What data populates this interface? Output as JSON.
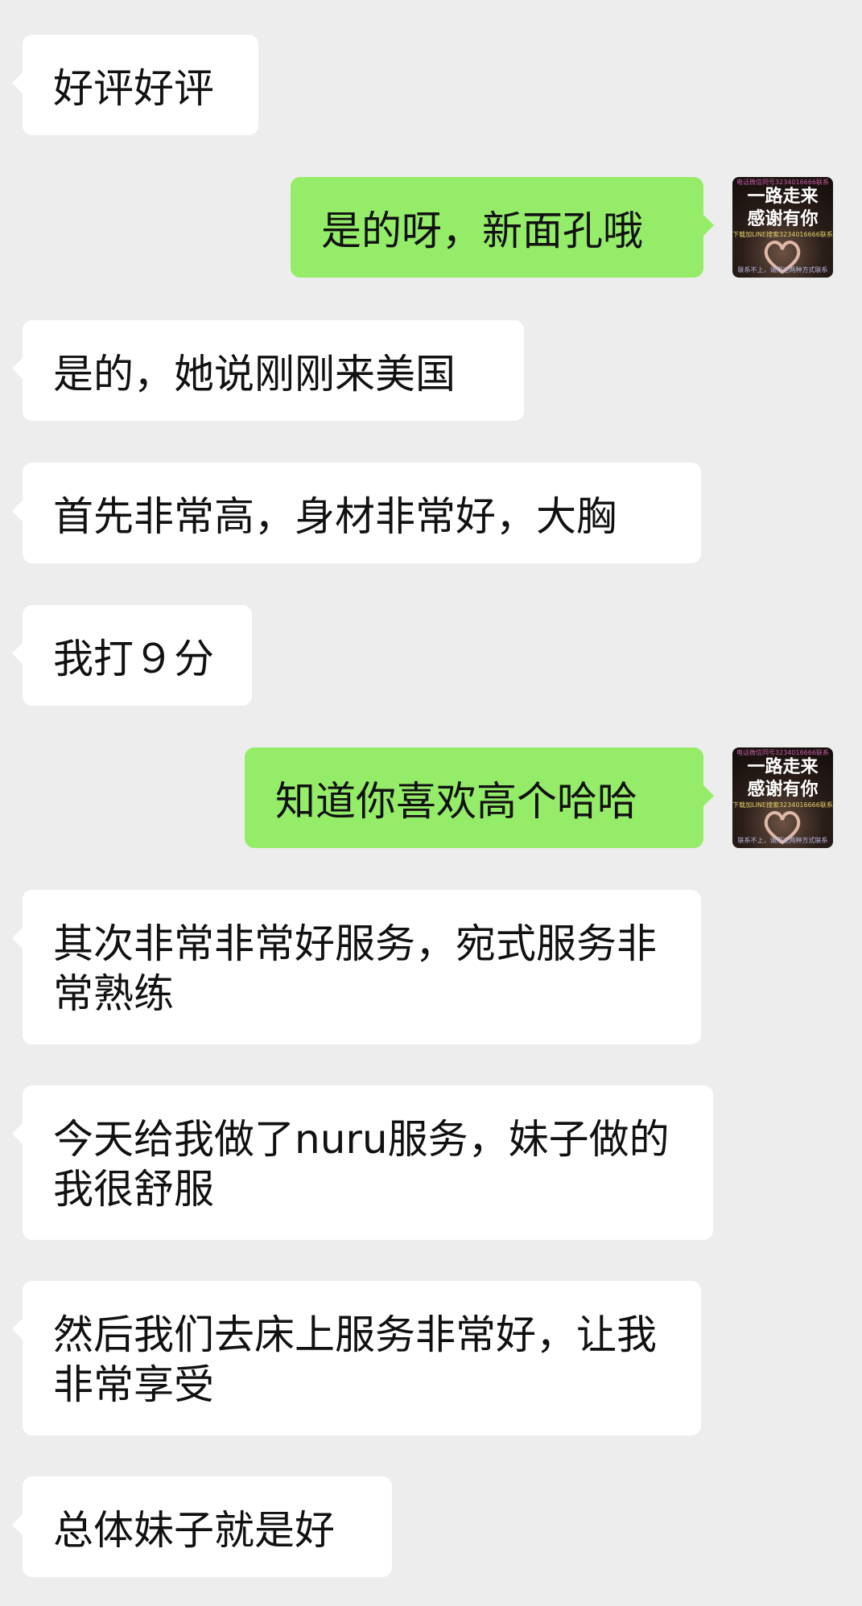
{
  "messages": [
    {
      "side": "in",
      "text": "好评好评"
    },
    {
      "side": "out",
      "text": "是的呀，新面孔哦"
    },
    {
      "side": "in",
      "text": "是的，她说刚刚来美国"
    },
    {
      "side": "in",
      "text": "首先非常高，身材非常好，大胸"
    },
    {
      "side": "in",
      "text": "我打９分"
    },
    {
      "side": "out",
      "text": "知道你喜欢高个哈哈"
    },
    {
      "side": "in",
      "text": "其次非常非常好服务，宛式服务非常熟练"
    },
    {
      "side": "in",
      "text": "今天给我做了nuru服务，妹子做的我很舒服"
    },
    {
      "side": "in",
      "text": "然后我们去床上服务非常好，让我非常享受"
    },
    {
      "side": "in",
      "text": "总体妹子就是好"
    }
  ],
  "avatar": {
    "title_line1": "一路走来",
    "title_line2": "感谢有你",
    "top_text": "电话微信同号3234016666联系",
    "mid_text": "下载加LINE搜索3234016666联系",
    "bottom_text": "联系不上，请用这两种方式联系"
  },
  "colors": {
    "background": "#ededed",
    "incoming_bubble": "#ffffff",
    "outgoing_bubble": "#95ec69",
    "text": "#111111"
  }
}
